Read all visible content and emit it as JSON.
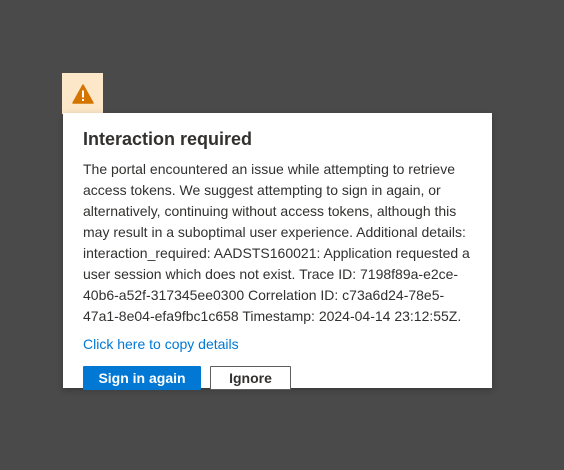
{
  "dialog": {
    "title": "Interaction required",
    "message": "The portal encountered an issue while attempting to retrieve access tokens. We suggest attempting to sign in again, or alternatively, continuing without access tokens, although this may result in a suboptimal user experience. Additional details: interaction_required: AADSTS160021: Application requested a user session which does not exist. Trace ID: 7198f89a-e2ce-40b6-a52f-317345ee0300 Correlation ID: c73a6d24-78e5-47a1-8e04-efa9fbc1c658 Timestamp: 2024-04-14 23:12:55Z.",
    "copy_link_label": "Click here to copy details",
    "primary_button_label": "Sign in again",
    "secondary_button_label": "Ignore",
    "icon": "warning-icon"
  },
  "colors": {
    "overlay": "#4a4a4a",
    "warning_background": "#fde7c9",
    "warning_icon": "#d47500",
    "accent": "#0078d4",
    "text": "#323130"
  }
}
